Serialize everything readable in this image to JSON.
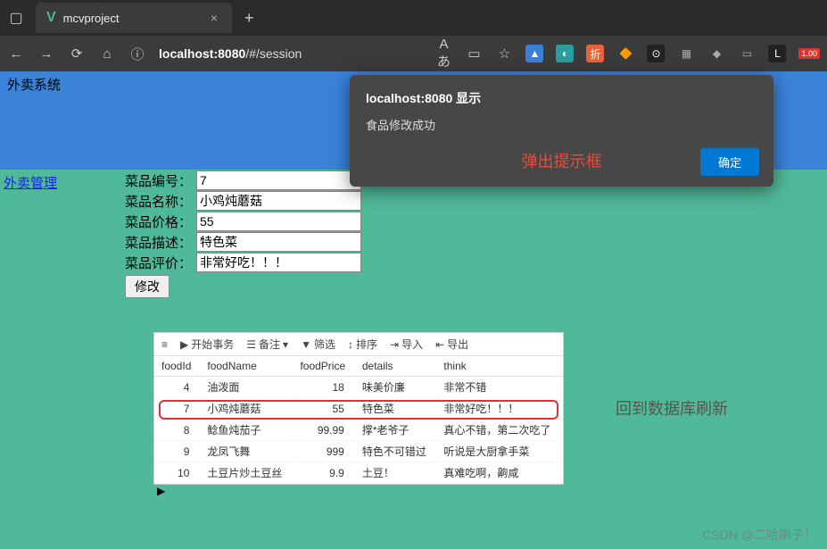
{
  "browser": {
    "tab_title": "mcvproject",
    "url_host": "localhost:8080",
    "url_path": "/#/session"
  },
  "header": {
    "title": "外卖系统"
  },
  "sidebar": {
    "link": "外卖管理"
  },
  "form": {
    "labels": {
      "id": "菜品编号：",
      "name": "菜品名称：",
      "price": "菜品价格：",
      "desc": "菜品描述：",
      "review": "菜品评价："
    },
    "values": {
      "id": "7",
      "name": "小鸡炖蘑菇",
      "price": "55",
      "desc": "特色菜",
      "review": "非常好吃！！！"
    },
    "submit": "修改"
  },
  "alert": {
    "title": "localhost:8080 显示",
    "message": "食品修改成功",
    "annotation": "弹出提示框",
    "ok": "确定"
  },
  "db": {
    "toolbar": {
      "start": "开始事务",
      "memo": "备注",
      "filter": "筛选",
      "sort": "排序",
      "import": "导入",
      "export": "导出"
    },
    "columns": [
      "foodId",
      "foodName",
      "foodPrice",
      "details",
      "think"
    ],
    "rows": [
      {
        "id": "4",
        "name": "油泼面",
        "price": "18",
        "details": "味美价廉",
        "think": "非常不错"
      },
      {
        "id": "7",
        "name": "小鸡炖蘑菇",
        "price": "55",
        "details": "特色菜",
        "think": "非常好吃！！！"
      },
      {
        "id": "8",
        "name": "鲶鱼炖茄子",
        "price": "99.99",
        "details": "撑*老爷子",
        "think": "真心不错，第二次吃了"
      },
      {
        "id": "9",
        "name": "龙凤飞舞",
        "price": "999",
        "details": "特色不可错过",
        "think": "听说是大厨拿手菜"
      },
      {
        "id": "10",
        "name": "土豆片炒土豆丝",
        "price": "9.9",
        "details": "土豆！",
        "think": "真难吃啊，齁咸"
      }
    ]
  },
  "annotations": {
    "right": "回到数据库刷新"
  },
  "watermark": "CSDN @二哈喇子！"
}
